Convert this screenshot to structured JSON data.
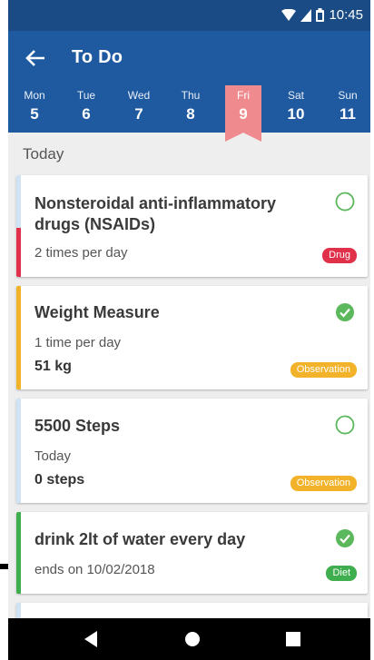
{
  "status_bar": {
    "time": "10:45"
  },
  "app_bar": {
    "title": "To Do",
    "days": [
      {
        "name": "Mon",
        "date": "5"
      },
      {
        "name": "Tue",
        "date": "6"
      },
      {
        "name": "Wed",
        "date": "7"
      },
      {
        "name": "Thu",
        "date": "8"
      },
      {
        "name": "Fri",
        "date": "9"
      },
      {
        "name": "Sat",
        "date": "10"
      },
      {
        "name": "Sun",
        "date": "11"
      }
    ],
    "selected_day": "Fri"
  },
  "section": {
    "label": "Today"
  },
  "tasks": [
    {
      "title_line1": "Nonsteroidal anti-inflammatory",
      "title_line2": "drugs (NSAIDs)",
      "subtitle": "2 times per day",
      "value": "",
      "badge": "Drug",
      "completed": false
    },
    {
      "title": "Weight Measure",
      "subtitle": "1 time per day",
      "value": "51 kg",
      "badge": "Observation",
      "completed": true
    },
    {
      "title": "5500 Steps",
      "subtitle": "Today",
      "value": "0 steps",
      "badge": "Observation",
      "completed": false
    },
    {
      "title": "drink 2lt of water every day",
      "subtitle": "ends on 10/02/2018",
      "value": "",
      "badge": "Diet",
      "completed": true
    }
  ],
  "colors": {
    "status_bar": "#1a4b84",
    "app_bar": "#1f5aa0",
    "selected_day": "#ef8b8e",
    "drug": "#e0304a",
    "observation": "#f2b32b",
    "diet": "#3fae4e",
    "pending_stripe": "#cfe3f5",
    "check_done": "#5cb85c"
  },
  "icons": [
    "back-arrow-icon",
    "wifi-icon",
    "signal-icon",
    "battery-icon",
    "check-circle-icon",
    "empty-circle-icon",
    "back-triangle-icon",
    "home-circle-icon",
    "recents-square-icon"
  ]
}
